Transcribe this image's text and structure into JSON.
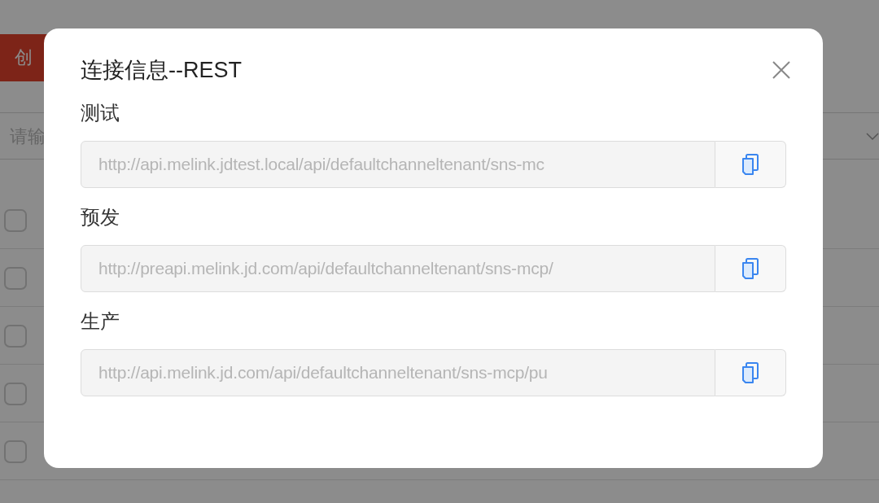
{
  "background_page": {
    "create_button": "创",
    "search_field": {
      "placeholder": "请输"
    },
    "rows": [
      {
        "checked": false
      },
      {
        "checked": false
      },
      {
        "checked": false
      },
      {
        "checked": false
      },
      {
        "checked": false
      }
    ]
  },
  "dialog": {
    "title": "连接信息--REST",
    "sections": [
      {
        "label": "测试",
        "url": "http://api.melink.jdtest.local/api/defaultchanneltenant/sns-mc"
      },
      {
        "label": "预发",
        "url": "http://preapi.melink.jd.com/api/defaultchanneltenant/sns-mcp/"
      },
      {
        "label": "生产",
        "url": "http://api.melink.jd.com/api/defaultchanneltenant/sns-mcp/pu"
      }
    ]
  }
}
